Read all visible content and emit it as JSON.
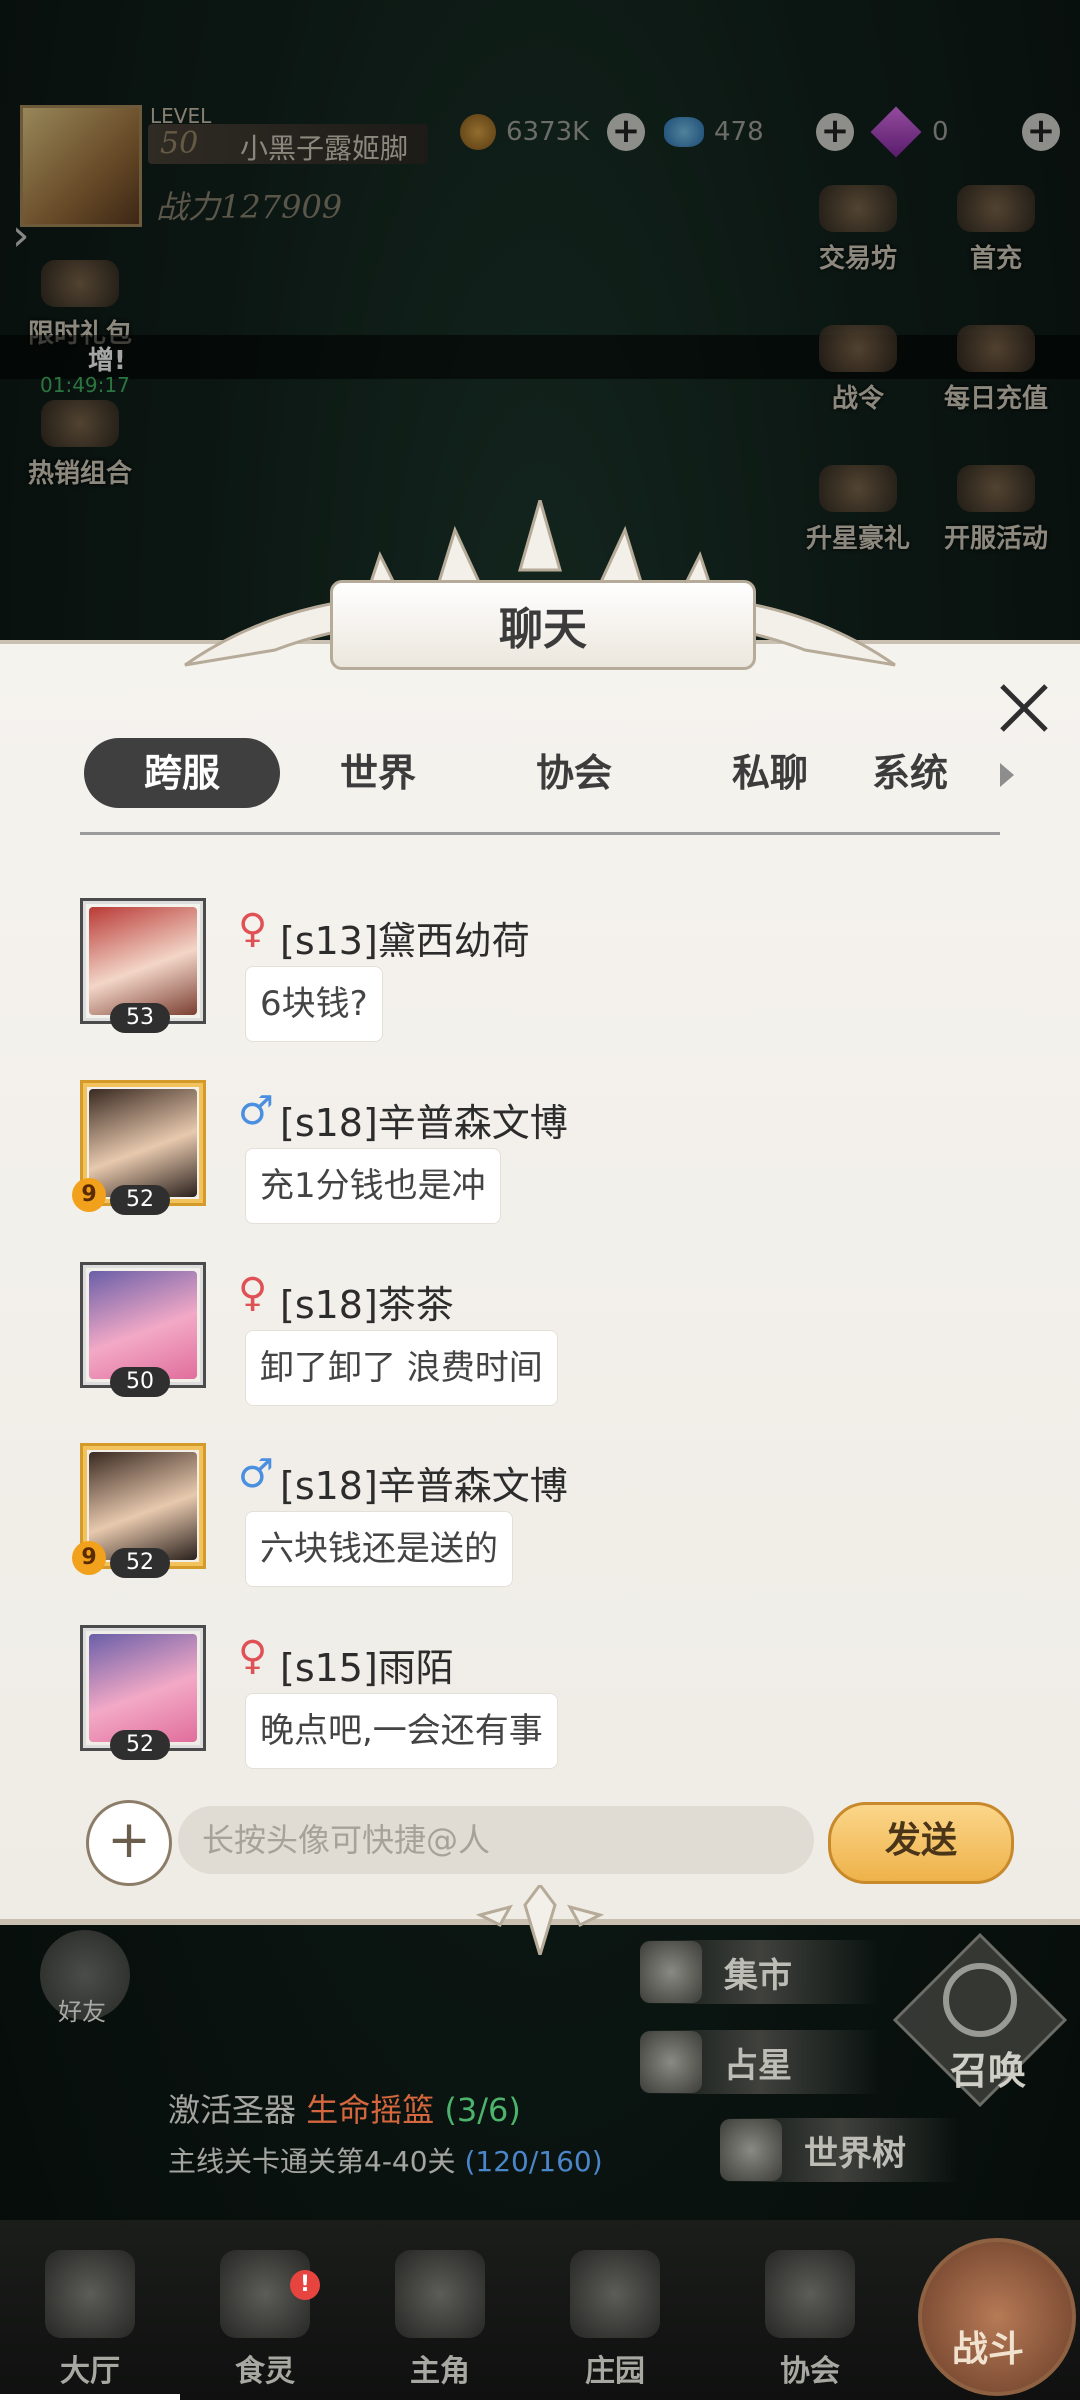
{
  "hud": {
    "level_label": "LEVEL",
    "level": "50",
    "player_name": "小黑子露姬脚",
    "power": "战力127909",
    "gold": "6373K",
    "gems": "478",
    "diamonds": "0",
    "timer": "01:49:17",
    "toast": "增!",
    "left_icons": [
      "限时礼包",
      "热销组合"
    ],
    "right_icons": [
      "交易坊",
      "首充",
      "战令",
      "每日充值",
      "升星豪礼",
      "开服活动"
    ]
  },
  "chat": {
    "title": "聊天",
    "tabs": [
      "跨服",
      "世界",
      "协会",
      "私聊",
      "系统"
    ],
    "active_tab": "跨服",
    "messages": [
      {
        "sex": "♀",
        "name": "[s13]黛西幼荷",
        "level": "53",
        "text": "6块钱?"
      },
      {
        "sex": "♂",
        "name": "[s18]辛普森文博",
        "level": "52",
        "badge": "9",
        "text": "充1分钱也是冲"
      },
      {
        "sex": "♀",
        "name": "[s18]茶茶",
        "level": "50",
        "text": "卸了卸了  浪费时间"
      },
      {
        "sex": "♂",
        "name": "[s18]辛普森文博",
        "level": "52",
        "badge": "9",
        "text": "六块钱还是送的"
      },
      {
        "sex": "♀",
        "name": "[s15]雨陌",
        "level": "52",
        "text": "晚点吧,一会还有事"
      }
    ],
    "input_placeholder": "长按头像可快捷@人",
    "send_label": "发送"
  },
  "lower": {
    "friend_label": "好友",
    "quest1_prefix": "激活圣器",
    "quest1_item": "生命摇篮",
    "quest1_progress": "(3/6)",
    "quest2_text": "主线关卡通关第4-40关",
    "quest2_progress": "(120/160)",
    "hub_buttons": [
      "集市",
      "占星",
      "世界树"
    ],
    "summon": "召唤"
  },
  "nav": {
    "items": [
      "大厅",
      "食灵",
      "主角",
      "庄园",
      "协会"
    ],
    "battle": "战斗",
    "alert": "!"
  },
  "colors": {
    "female": "#e05156",
    "male": "#4a8fe0",
    "send_button": "#eeb24a",
    "tab_active": "#3f3f3f"
  }
}
